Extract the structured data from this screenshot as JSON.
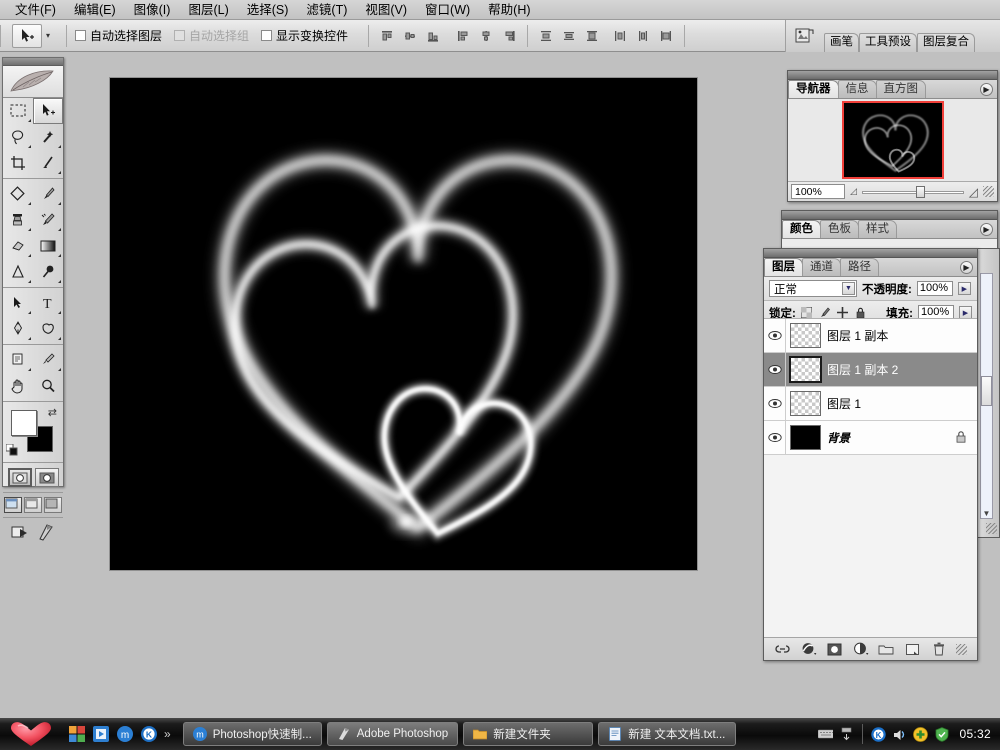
{
  "app": {
    "title": "Adobe Photoshop",
    "menu": [
      "文件(F)",
      "编辑(E)",
      "图像(I)",
      "图层(L)",
      "选择(S)",
      "滤镜(T)",
      "视图(V)",
      "窗口(W)",
      "帮助(H)"
    ]
  },
  "options_bar": {
    "tool_icon": "move-tool-icon",
    "tool_preset_arrow": "▾",
    "checkboxes": [
      {
        "label": "自动选择图层",
        "checked": false,
        "disabled": false
      },
      {
        "label": "自动选择组",
        "checked": false,
        "disabled": true
      },
      {
        "label": "显示变换控件",
        "checked": false,
        "disabled": false
      }
    ],
    "align_group_1": [
      "align-top-edges-icon",
      "align-vertical-centers-icon",
      "align-bottom-edges-icon"
    ],
    "align_group_2": [
      "align-left-edges-icon",
      "align-horizontal-centers-icon",
      "align-right-edges-icon"
    ],
    "distribute_group_1": [
      "distribute-top-edges-icon",
      "distribute-vertical-centers-icon",
      "distribute-bottom-edges-icon"
    ],
    "distribute_group_2": [
      "distribute-left-edges-icon",
      "distribute-horizontal-centers-icon",
      "distribute-right-edges-icon"
    ]
  },
  "palette_well": {
    "icon": "palette-well-icon",
    "tabs": [
      "画笔",
      "工具预设",
      "图层复合"
    ]
  },
  "toolbox": {
    "logo": "feather-logo-icon",
    "tools": [
      {
        "name": "marquee-tool",
        "glyph": "▭",
        "selected": false,
        "has_flyout": true
      },
      {
        "name": "move-tool",
        "glyph": "➤",
        "selected": true,
        "has_flyout": false
      },
      {
        "name": "lasso-tool",
        "glyph": "◠",
        "selected": false,
        "has_flyout": true
      },
      {
        "name": "magic-wand-tool",
        "glyph": "✦",
        "selected": false,
        "has_flyout": false
      },
      {
        "name": "crop-tool",
        "glyph": "⌗",
        "selected": false,
        "has_flyout": false
      },
      {
        "name": "slice-tool",
        "glyph": "✂",
        "selected": false,
        "has_flyout": true
      },
      {
        "name": "healing-brush-tool",
        "glyph": "◇",
        "selected": false,
        "has_flyout": true
      },
      {
        "name": "brush-tool",
        "glyph": "✎",
        "selected": false,
        "has_flyout": true
      },
      {
        "name": "clone-stamp-tool",
        "glyph": "♟",
        "selected": false,
        "has_flyout": true
      },
      {
        "name": "history-brush-tool",
        "glyph": "✐",
        "selected": false,
        "has_flyout": true
      },
      {
        "name": "eraser-tool",
        "glyph": "▰",
        "selected": false,
        "has_flyout": true
      },
      {
        "name": "gradient-tool",
        "glyph": "▤",
        "selected": false,
        "has_flyout": true
      },
      {
        "name": "blur-tool",
        "glyph": "△",
        "selected": false,
        "has_flyout": true
      },
      {
        "name": "dodge-tool",
        "glyph": "●",
        "selected": false,
        "has_flyout": true
      },
      {
        "name": "path-selection-tool",
        "glyph": "➘",
        "selected": false,
        "has_flyout": true
      },
      {
        "name": "type-tool",
        "glyph": "T",
        "selected": false,
        "has_flyout": true
      },
      {
        "name": "pen-tool",
        "glyph": "✒",
        "selected": false,
        "has_flyout": true
      },
      {
        "name": "custom-shape-tool",
        "glyph": "⬠",
        "selected": false,
        "has_flyout": true
      },
      {
        "name": "notes-tool",
        "glyph": "▤",
        "selected": false,
        "has_flyout": true
      },
      {
        "name": "eyedropper-tool",
        "glyph": "⚲",
        "selected": false,
        "has_flyout": true
      },
      {
        "name": "hand-tool",
        "glyph": "✋",
        "selected": false,
        "has_flyout": false
      },
      {
        "name": "zoom-tool",
        "glyph": "⌕",
        "selected": false,
        "has_flyout": false
      }
    ],
    "foreground_color": "#ffffff",
    "background_color": "#000000",
    "swap_icon": "swap-colors-icon",
    "default_icon": "default-colors-icon",
    "quick_mask": [
      "standard-mode-icon",
      "quick-mask-mode-icon"
    ],
    "screen_modes": [
      "standard-screen-mode-icon",
      "full-screen-menubar-icon",
      "full-screen-icon"
    ],
    "jump_to": [
      "jump-to-imageready-icon",
      "imageready-icon"
    ]
  },
  "document": {
    "title": "heart-artwork",
    "background": "#000000",
    "artwork": "three-overlapping-glowing-hearts"
  },
  "navigator": {
    "tabs": [
      "导航器",
      "信息",
      "直方图"
    ],
    "active_tab": "导航器",
    "menu_icon": "panel-menu-icon",
    "zoom_value": "100%",
    "zoom_out_icon": "zoom-out-icon",
    "zoom_in_icon": "zoom-in-icon",
    "view_box_color": "#f1403a",
    "resize_grip": "resize-grip-icon"
  },
  "color_panel": {
    "tabs": [
      "颜色",
      "色板",
      "样式"
    ],
    "active_tab": "颜色",
    "menu_icon": "panel-menu-icon"
  },
  "layers_panel": {
    "tabs": [
      "图层",
      "通道",
      "路径"
    ],
    "active_tab": "图层",
    "menu_icon": "panel-menu-icon",
    "blend_mode": "正常",
    "opacity_label": "不透明度:",
    "opacity_value": "100%",
    "lock_label": "锁定:",
    "lock_buttons": [
      "lock-transparent-pixels-icon",
      "lock-image-pixels-icon",
      "lock-position-icon",
      "lock-all-icon"
    ],
    "fill_label": "填充:",
    "fill_value": "100%",
    "layers": [
      {
        "name": "图层 1 副本",
        "visible": true,
        "selected": false,
        "thumb": "transparent",
        "locked": false,
        "italic": false
      },
      {
        "name": "图层 1 副本 2",
        "visible": true,
        "selected": true,
        "thumb": "transparent",
        "locked": false,
        "italic": false
      },
      {
        "name": "图层 1",
        "visible": true,
        "selected": false,
        "thumb": "transparent",
        "locked": false,
        "italic": false
      },
      {
        "name": "背景",
        "visible": true,
        "selected": false,
        "thumb": "black",
        "locked": true,
        "italic": true
      }
    ],
    "footer_buttons": [
      "link-layers-icon",
      "add-layer-style-icon",
      "add-layer-mask-icon",
      "new-adjustment-layer-icon",
      "new-group-icon",
      "new-layer-icon",
      "delete-layer-icon"
    ],
    "resize_grip": "resize-grip-icon"
  },
  "taskbar": {
    "start_icon": "heart-start-icon",
    "quick_launch": [
      {
        "name": "show-desktop-icon",
        "glyph": "▦"
      },
      {
        "name": "media-player-icon",
        "glyph": "◨"
      },
      {
        "name": "maxthon-icon",
        "glyph": "m"
      },
      {
        "name": "kingsoft-icon",
        "glyph": "K"
      }
    ],
    "quick_launch_more": "»",
    "tasks": [
      {
        "label": "Photoshop快速制...",
        "icon": "maxthon-icon",
        "active": false
      },
      {
        "label": "Adobe Photoshop",
        "icon": "photoshop-icon",
        "active": true
      },
      {
        "label": "新建文件夹",
        "icon": "folder-icon",
        "active": false
      },
      {
        "label": "新建 文本文档.txt...",
        "icon": "notepad-icon",
        "active": false
      }
    ],
    "tray": [
      {
        "name": "language-bar-icon",
        "glyph": "⌨"
      },
      {
        "name": "ime-toolbar-icon",
        "glyph": "⌸"
      },
      {
        "name": "kingsoft-tray-icon",
        "glyph": "K"
      },
      {
        "name": "volume-tray-icon",
        "glyph": "♪"
      },
      {
        "name": "update-tray-icon",
        "glyph": "✚"
      },
      {
        "name": "security-shield-icon",
        "glyph": "🛡"
      }
    ],
    "clock": "05:32"
  }
}
